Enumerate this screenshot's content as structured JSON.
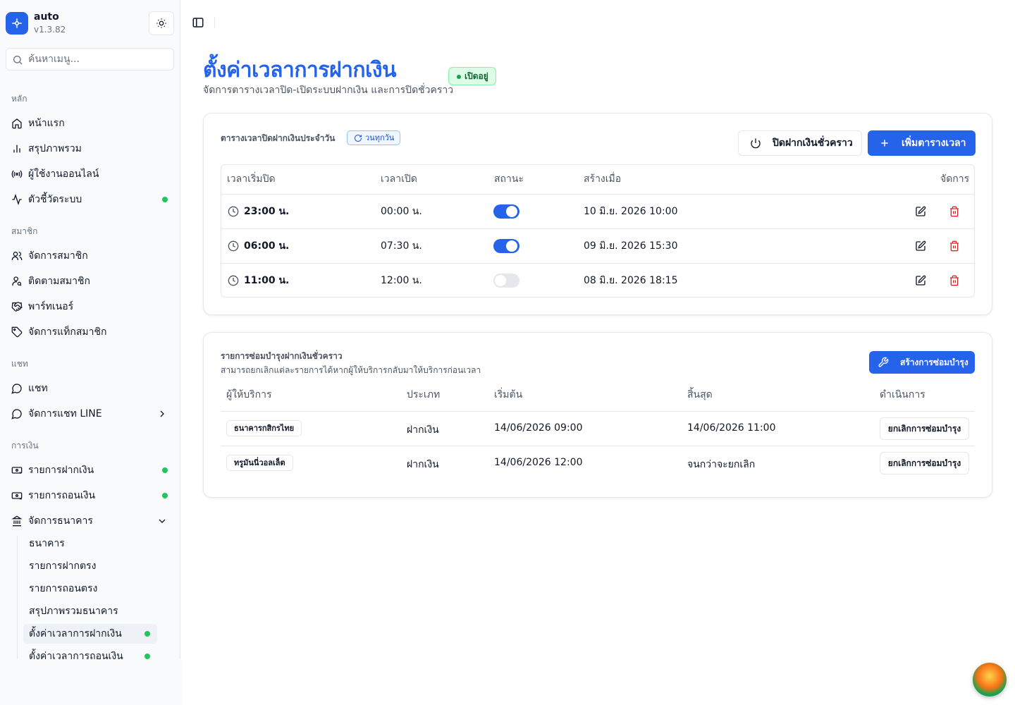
{
  "app": {
    "name": "auto",
    "version": "v1.3.82"
  },
  "search": {
    "placeholder": "ค้นหาเมนู..."
  },
  "sidebar": {
    "sections": {
      "main": "หลัก",
      "members": "สมาชิก",
      "chat": "แชท",
      "finance": "การเงิน"
    },
    "main_items": [
      {
        "label": "หน้าแรก",
        "icon": "home-icon"
      },
      {
        "label": "สรุปภาพรวม",
        "icon": "bar-chart-icon"
      },
      {
        "label": "ผู้ใช้งานออนไลน์",
        "icon": "radio-icon"
      },
      {
        "label": "ตัวชี้วัดระบบ",
        "icon": "activity-icon",
        "status_dot": true
      }
    ],
    "member_items": [
      {
        "label": "จัดการสมาชิก",
        "icon": "users-icon"
      },
      {
        "label": "ติดตามสมาชิก",
        "icon": "user-search-icon"
      },
      {
        "label": "พาร์ทเนอร์",
        "icon": "handshake-icon"
      },
      {
        "label": "จัดการแท็กสมาชิก",
        "icon": "tag-icon"
      }
    ],
    "chat_items": [
      {
        "label": "แชท",
        "icon": "message-circle-icon"
      },
      {
        "label": "จัดการแชท LINE",
        "icon": "message-circle-icon",
        "expandable": true
      }
    ],
    "finance_items": [
      {
        "label": "รายการฝากเงิน",
        "icon": "deposit-icon",
        "status_dot": true
      },
      {
        "label": "รายการถอนเงิน",
        "icon": "withdraw-icon",
        "status_dot": true
      },
      {
        "label": "จัดการธนาคาร",
        "icon": "bank-icon",
        "expanded": true
      }
    ],
    "bank_sub_items": [
      {
        "label": "ธนาคาร"
      },
      {
        "label": "รายการฝากตรง"
      },
      {
        "label": "รายการถอนตรง"
      },
      {
        "label": "สรุปภาพรวมธนาคาร"
      },
      {
        "label": "ตั้งค่าเวลาการฝากเงิน",
        "active": true,
        "status_dot": true
      },
      {
        "label": "ตั้งค่าเวลาการถอนเงิน",
        "status_dot": true
      }
    ]
  },
  "page": {
    "title": "ตั้งค่าเวลาการฝากเงิน",
    "subtitle": "จัดการตารางเวลาปิด-เปิดระบบฝากเงิน และการปิดชั่วคราว",
    "status_badge": "เปิดอยู่",
    "status_color": "#16a34a"
  },
  "schedule": {
    "title": "ตารางเวลาปิดฝากเงินประจำวัน",
    "badge": "วนทุกวัน",
    "temp_close_button": "ปิดฝากเงินชั่วคราว",
    "add_button": "เพิ่มตารางเวลา",
    "columns": [
      "เวลาเริ่มปิด",
      "เวลาเปิด",
      "สถานะ",
      "สร้างเมื่อ",
      "จัดการ"
    ],
    "rows": [
      {
        "start": "23:00 น.",
        "end": "00:00 น.",
        "enabled": true,
        "created": "10 มิ.ย. 2026 10:00"
      },
      {
        "start": "06:00 น.",
        "end": "07:30 น.",
        "enabled": true,
        "created": "09 มิ.ย. 2026 15:30"
      },
      {
        "start": "11:00 น.",
        "end": "12:00 น.",
        "enabled": false,
        "created": "08 มิ.ย. 2026 18:15"
      }
    ]
  },
  "maintenance": {
    "title": "รายการซ่อมบำรุงฝากเงินชั่วคราว",
    "subtitle": "สามารถยกเลิกแต่ละรายการได้หากผู้ให้บริการกลับมาให้บริการก่อนเวลา",
    "create_button": "สร้างการซ่อมบำรุง",
    "columns": [
      "ผู้ให้บริการ",
      "ประเภท",
      "เริ่มต้น",
      "สิ้นสุด",
      "ดำเนินการ"
    ],
    "rows": [
      {
        "provider": "ธนาคารกสิกรไทย",
        "type": "ฝากเงิน",
        "start": "14/06/2026 09:00",
        "end": "14/06/2026 11:00",
        "action": "ยกเลิกการซ่อมบำรุง"
      },
      {
        "provider": "ทรูมันนี่วอลเล็ต",
        "type": "ฝากเงิน",
        "start": "14/06/2026 12:00",
        "end": "จนกว่าจะยกเลิก",
        "action": "ยกเลิกการซ่อมบำรุง"
      }
    ]
  },
  "colors": {
    "accent": "#2563eb",
    "success": "#22c55e",
    "danger": "#dc2626"
  }
}
